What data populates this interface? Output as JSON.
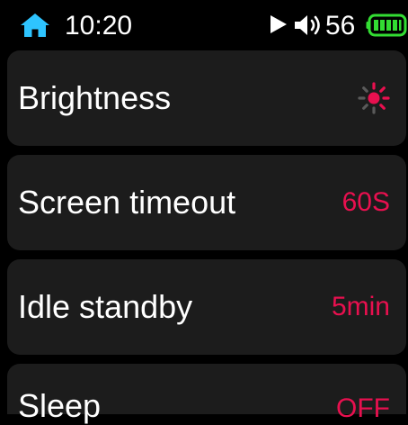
{
  "status_bar": {
    "time": "10:20",
    "volume": "56",
    "icons": {
      "home": "home-icon",
      "media": "play-icon",
      "volume": "volume-icon",
      "battery": "battery-icon"
    },
    "battery_level": 1.0,
    "battery_color": "#33dd33",
    "home_color": "#2ec4ff"
  },
  "settings": [
    {
      "label": "Brightness",
      "value": "",
      "icon": "sun-icon"
    },
    {
      "label": "Screen timeout",
      "value": "60S"
    },
    {
      "label": "Idle standby",
      "value": "5min"
    },
    {
      "label": "Sleep",
      "value": "OFF"
    }
  ],
  "colors": {
    "accent": "#e8104f",
    "card_background": "#1c1c1c",
    "background": "#000000",
    "brightness_icon_dim": "#5a5a5a"
  }
}
